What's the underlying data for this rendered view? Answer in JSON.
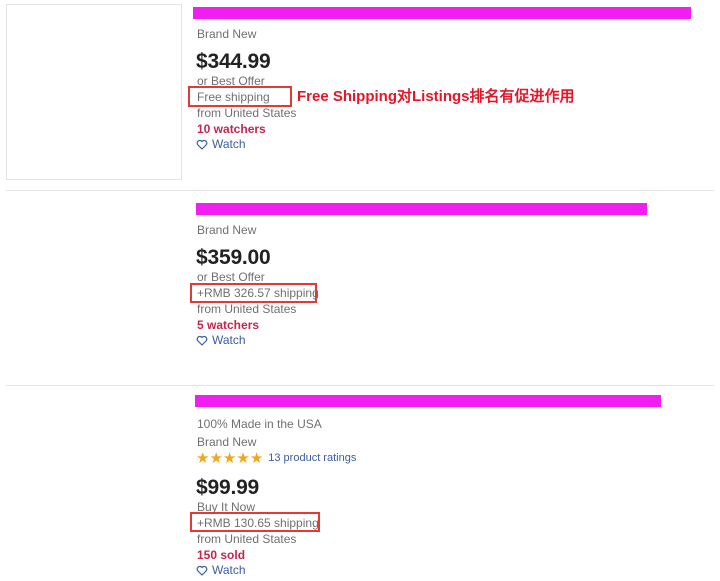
{
  "listings": [
    {
      "condition": "Brand New",
      "price": "$344.99",
      "purchase_option": "or Best Offer",
      "shipping": "Free shipping",
      "location": "from United States",
      "social": "10 watchers",
      "watch_label": "Watch"
    },
    {
      "condition": "Brand New",
      "price": "$359.00",
      "purchase_option": "or Best Offer",
      "shipping": "+RMB 326.57 shipping",
      "location": "from United States",
      "social": "5 watchers",
      "watch_label": "Watch"
    },
    {
      "subtitle": "100% Made in the USA",
      "condition": "Brand New",
      "rating_stars": 5,
      "rating_text": "13 product ratings",
      "price": "$99.99",
      "purchase_option": "Buy It Now",
      "shipping": "+RMB 130.65 shipping",
      "location": "from United States",
      "social": "150 sold",
      "watch_label": "Watch"
    }
  ],
  "annotation": "Free Shipping对Listings排名有促进作用",
  "colors": {
    "title_redaction": "#f01ef0",
    "highlight_box": "#e53935",
    "annotation_text": "#e5162a",
    "watchers": "#c7244f",
    "link": "#3a5ea0",
    "star": "#f2a61c"
  },
  "icons": [
    "heart-outline-icon",
    "star-icon"
  ]
}
